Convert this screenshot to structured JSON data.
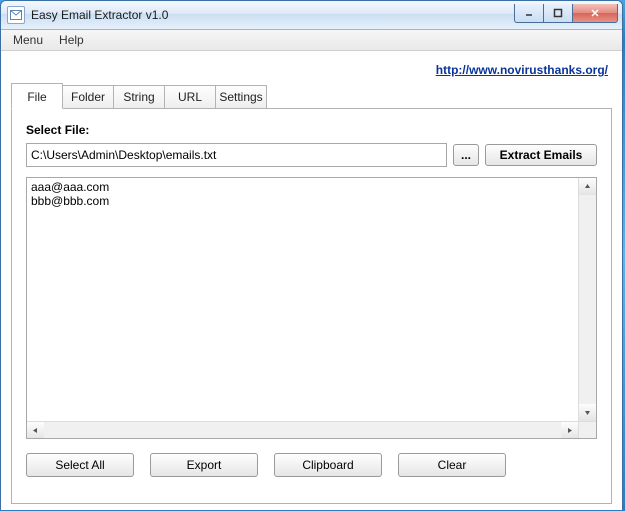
{
  "window": {
    "title": "Easy Email Extractor v1.0"
  },
  "menubar": {
    "menu": "Menu",
    "help": "Help"
  },
  "link": {
    "text": "http://www.novirusthanks.org/",
    "href": "http://www.novirusthanks.org/"
  },
  "tabs": {
    "file": "File",
    "folder": "Folder",
    "string": "String",
    "url": "URL",
    "settings": "Settings"
  },
  "file_panel": {
    "label": "Select File:",
    "path_value": "C:\\Users\\Admin\\Desktop\\emails.txt",
    "browse_label": "...",
    "extract_label": "Extract Emails"
  },
  "results": {
    "lines": "aaa@aaa.com\nbbb@bbb.com"
  },
  "buttons": {
    "select_all": "Select All",
    "export": "Export",
    "clipboard": "Clipboard",
    "clear": "Clear"
  }
}
